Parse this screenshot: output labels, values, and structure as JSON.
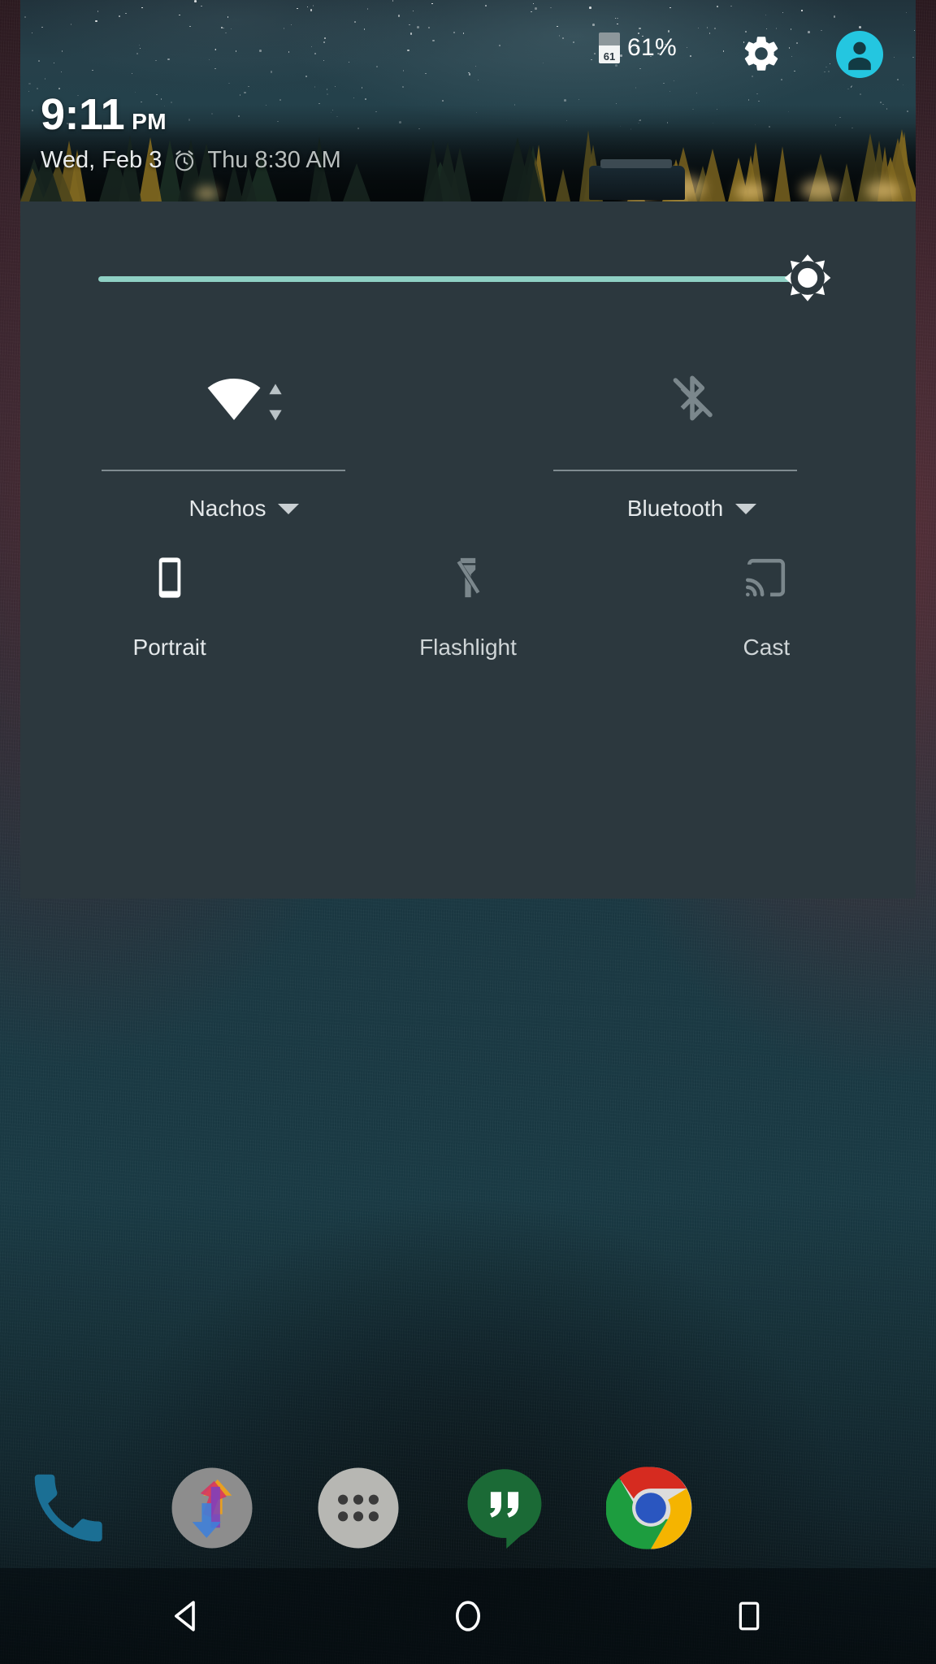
{
  "status_bar": {
    "battery_level_text": "61",
    "battery_percent_label": "61%",
    "settings_icon": "gear-icon",
    "user_icon": "account-avatar-icon",
    "user_accent_color": "#24c6e0"
  },
  "clock": {
    "time": "9:11",
    "ampm": "PM",
    "date": "Wed, Feb 3",
    "alarm_icon": "alarm-clock-icon",
    "alarm_text": "Thu 8:30 AM"
  },
  "brightness": {
    "icon": "brightness-sun-icon",
    "value_percent": 97,
    "track_color": "#8fd0c4"
  },
  "quick_settings": {
    "panel_color": "#2c383e",
    "top_tiles": [
      {
        "id": "wifi",
        "label": "Nachos",
        "icon": "wifi-full-signal-icon",
        "activity_icon": "data-activity-up-down-icon",
        "enabled": true,
        "has_dropdown": true,
        "chevron_icon": "chevron-down-icon"
      },
      {
        "id": "bluetooth",
        "label": "Bluetooth",
        "icon": "bluetooth-disabled-icon",
        "enabled": false,
        "has_dropdown": true,
        "chevron_icon": "chevron-down-icon"
      }
    ],
    "bottom_tiles": [
      {
        "id": "rotation",
        "label": "Portrait",
        "icon": "phone-portrait-icon",
        "enabled": true
      },
      {
        "id": "flashlight",
        "label": "Flashlight",
        "icon": "flashlight-off-icon",
        "enabled": false
      },
      {
        "id": "cast",
        "label": "Cast",
        "icon": "cast-screen-icon",
        "enabled": false
      }
    ]
  },
  "dock": {
    "items": [
      {
        "id": "phone",
        "icon": "phone-handset-icon"
      },
      {
        "id": "photos",
        "icon": "photos-sync-arrows-icon"
      },
      {
        "id": "app-drawer",
        "icon": "app-drawer-dots-icon"
      },
      {
        "id": "hangouts",
        "icon": "hangouts-quote-bubble-icon"
      },
      {
        "id": "chrome",
        "icon": "chrome-browser-icon"
      }
    ]
  },
  "nav_bar": {
    "back": {
      "icon": "back-triangle-icon"
    },
    "home": {
      "icon": "home-circle-icon"
    },
    "recents": {
      "icon": "recents-square-icon"
    }
  }
}
